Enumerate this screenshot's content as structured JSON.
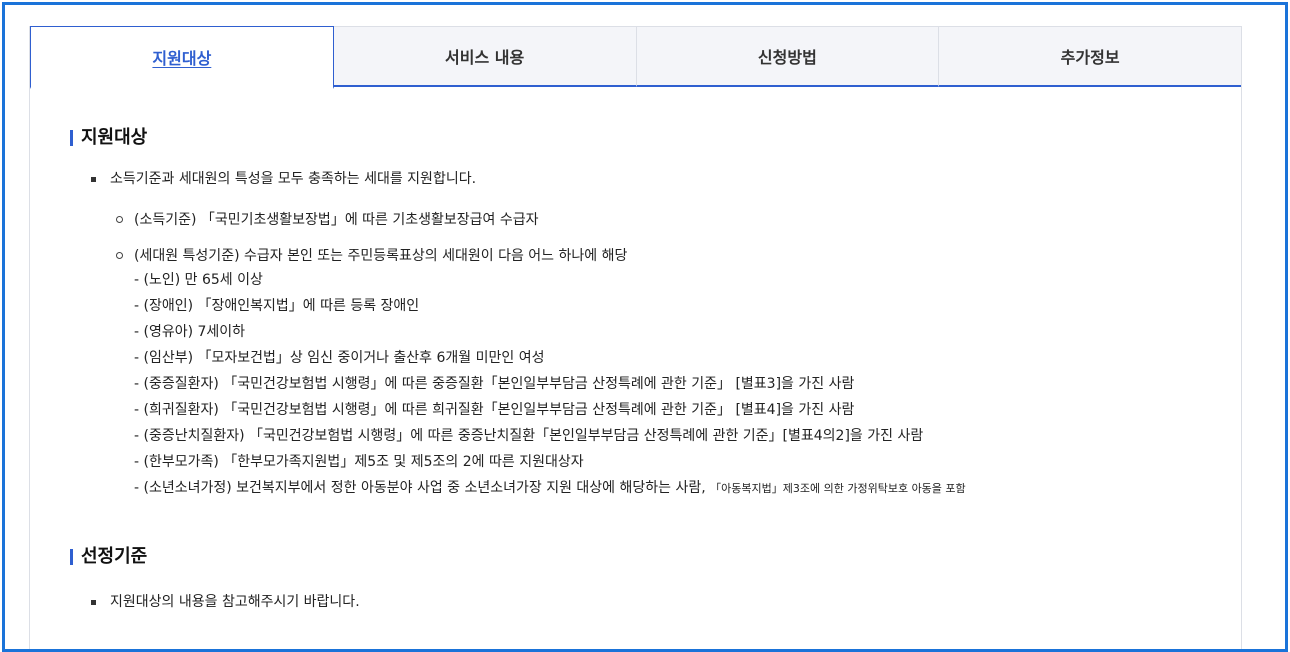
{
  "tabs": [
    {
      "label": "지원대상",
      "active": true
    },
    {
      "label": "서비스 내용",
      "active": false
    },
    {
      "label": "신청방법",
      "active": false
    },
    {
      "label": "추가정보",
      "active": false
    }
  ],
  "sections": {
    "eligibility": {
      "title": "지원대상",
      "intro": "소득기준과 세대원의 특성을 모두 충족하는 세대를 지원합니다.",
      "income": "(소득기준) 「국민기초생활보장법」에 따른 기초생활보장급여 수급자",
      "member_heading": "(세대원 특성기준) 수급자 본인 또는 주민등록표상의 세대원이 다음 어느 하나에 해당",
      "members": [
        "- (노인) 만 65세 이상",
        "- (장애인) 「장애인복지법」에 따른 등록 장애인",
        "- (영유아) 7세이하",
        "- (임산부) 「모자보건법」상 임신 중이거나 출산후 6개월 미만인 여성",
        "- (중증질환자) 「국민건강보험법 시행령」에 따른 중증질환「본인일부부담금 산정특례에 관한 기준」 [별표3]을 가진 사람",
        "- (희귀질환자) 「국민건강보험법 시행령」에 따른 희귀질환「본인일부부담금 산정특례에 관한 기준」 [별표4]을 가진 사람",
        "- (중증난치질환자) 「국민건강보험법 시행령」에 따른 중증난치질환「본인일부부담금 산정특례에 관한 기준」[별표4의2]을 가진 사람",
        "- (한부모가족) 「한부모가족지원법」제5조 및 제5조의 2에 따른 지원대상자"
      ],
      "last_member": "- (소년소녀가정) 보건복지부에서 정한 아동분야 사업 중 소년소녀가장 지원 대상에 해당하는 사람, ",
      "last_member_note": "「아동복지법」제3조에 의한 가정위탁보호 아동을 포함"
    },
    "criteria": {
      "title": "선정기준",
      "text": "지원대상의 내용을 참고해주시기 바랍니다."
    }
  },
  "colors": {
    "frame": "#1a73d9",
    "accent": "#2f5fd0",
    "tab_bg": "#f4f5f9",
    "border": "#dcdfe6"
  }
}
